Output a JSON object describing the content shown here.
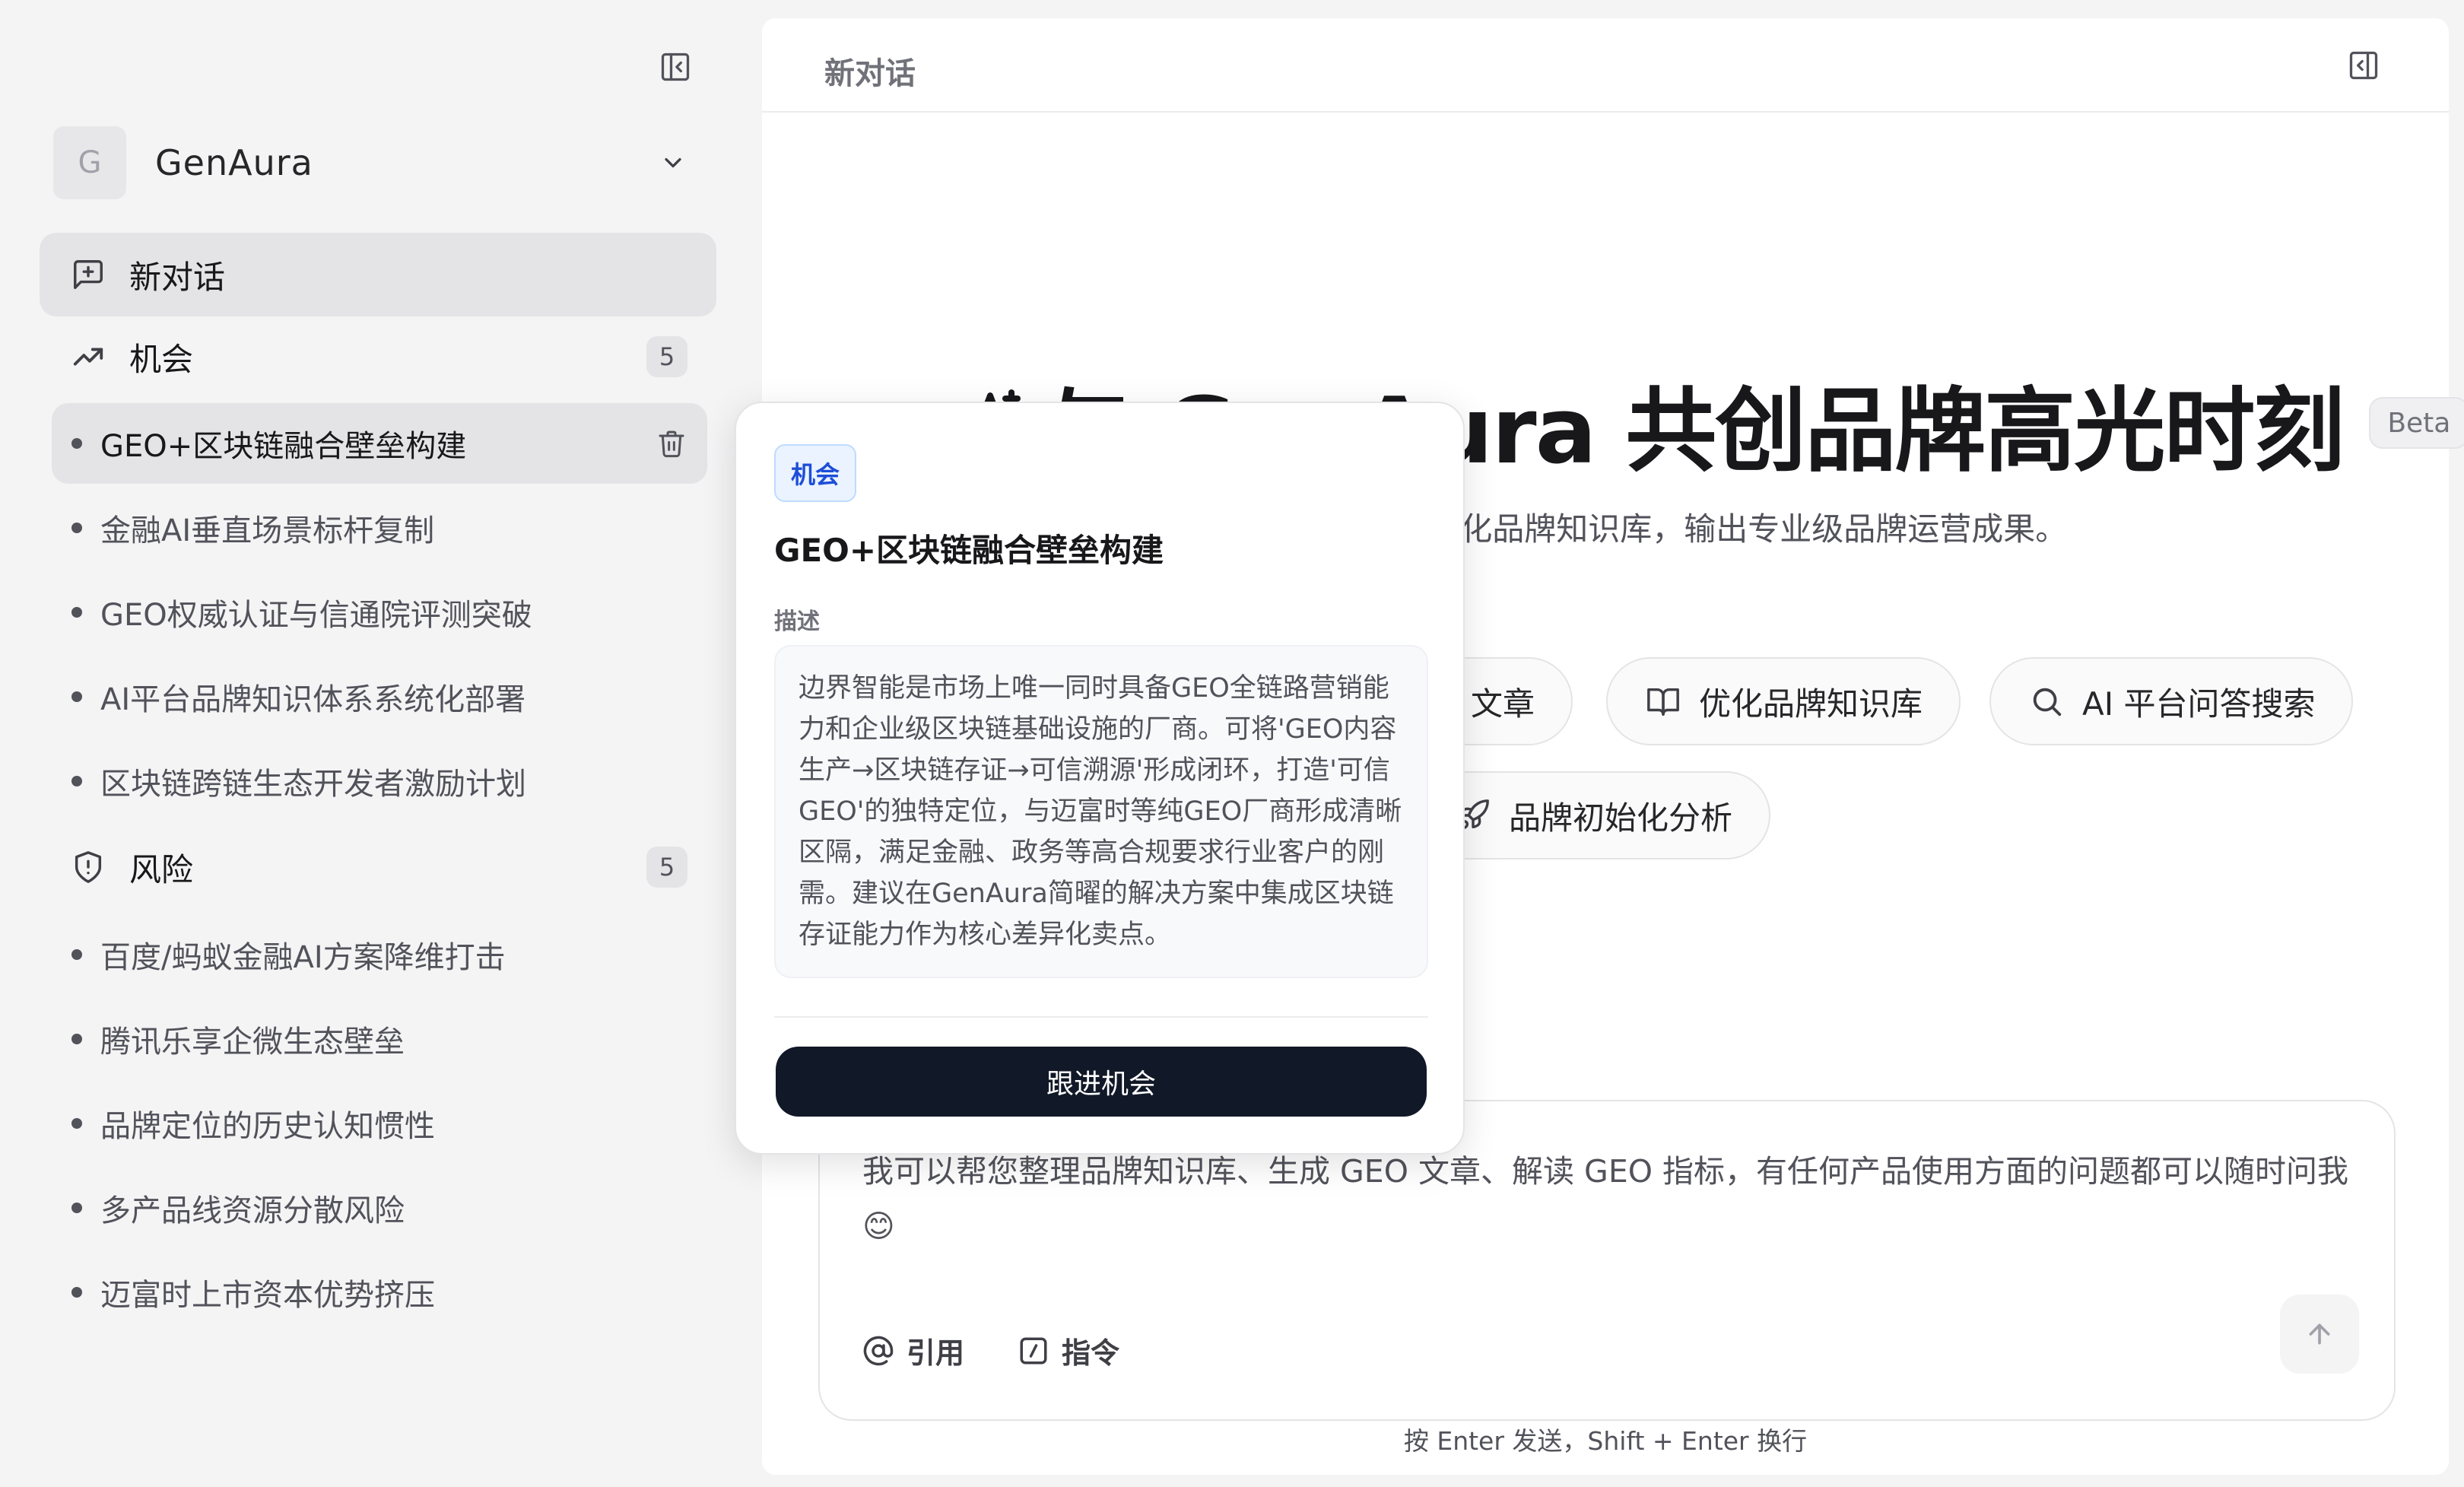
{
  "sidebar": {
    "workspace": {
      "avatar": "G",
      "name": "GenAura"
    },
    "new_chat": "新对话",
    "opportunities": {
      "label": "机会",
      "count": "5",
      "items": [
        "GEO+区块链融合壁垒构建",
        "金融AI垂直场景标杆复制",
        "GEO权威认证与信通院评测突破",
        "AI平台品牌知识体系系统化部署",
        "区块链跨链生态开发者激励计划"
      ]
    },
    "risks": {
      "label": "风险",
      "count": "5",
      "items": [
        "百度/蚂蚁金融AI方案降维打击",
        "腾讯乐享企微生态壁垒",
        "品牌定位的历史认知惯性",
        "多产品线资源分散风险",
        "迈富时上市资本优势挤压"
      ]
    }
  },
  "main": {
    "topbar_title": "新对话",
    "hero_title": "与 GenAura 共创品牌高光时刻",
    "beta": "Beta",
    "hero_subtitle": "O 文章、优化品牌知识库，输出专业级品牌运营成果。",
    "quick_actions": [
      "文章",
      "优化品牌知识库",
      "AI 平台问答搜索",
      "品牌初始化分析"
    ],
    "composer": {
      "text": "我可以帮您整理品牌知识库、生成 GEO 文章、解读 GEO 指标，有任何产品使用方面的问题都可以随时问我 😊",
      "mention": "引用",
      "command": "指令"
    },
    "hint": "按 Enter 发送，Shift + Enter 换行"
  },
  "popover": {
    "tag": "机会",
    "title": "GEO+区块链融合壁垒构建",
    "section": "描述",
    "description": "边界智能是市场上唯一同时具备GEO全链路营销能力和企业级区块链基础设施的厂商。可将'GEO内容生产→区块链存证→可信溯源'形成闭环，打造'可信GEO'的独特定位，与迈富时等纯GEO厂商形成清晰区隔，满足金融、政务等高合规要求行业客户的刚需。建议在GenAura简曜的解决方案中集成区块链存证能力作为核心差异化卖点。",
    "cta": "跟进机会"
  },
  "colors": {
    "background": "#f4f4f5",
    "panel": "#ffffff",
    "primary_button": "#111827",
    "tag_blue": "#1d4ed8"
  }
}
